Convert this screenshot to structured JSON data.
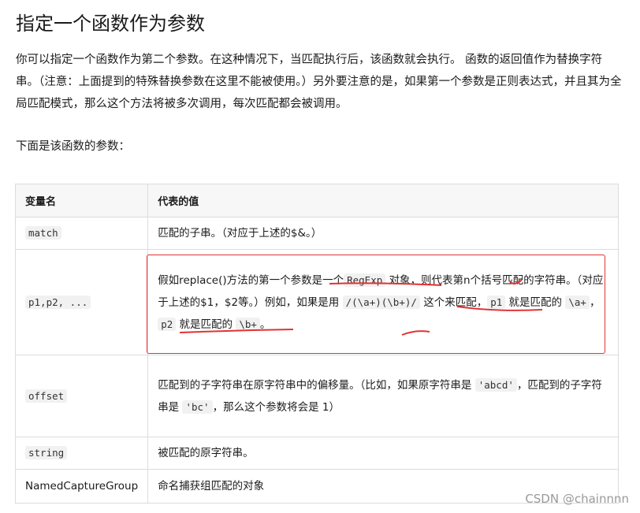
{
  "heading": "指定一个函数作为参数",
  "intro": {
    "line1": "你可以指定一个函数作为第二个参数。在这种情况下，当匹配执行后，该函数就会执行。 函数的返回值作为替换字符串。（注意：上面提到的特殊替换参数在这里不能被使用。）另外要注意的是，如果第一个参数是正则表达式，并且其为全局匹配模式，那么这个方法将被多次调用，每次匹配都会被调用。",
    "line2": "下面是该函数的参数："
  },
  "table": {
    "headers": [
      "变量名",
      "代表的值"
    ],
    "rows": [
      {
        "name": "match",
        "value": "匹配的子串。（对应于上述的$&。）"
      },
      {
        "name": "p1,p2, ...",
        "value_parts": {
          "a": "假如replace()方法的第一个参数是一个",
          "code1": "RegExp",
          "b": " 对象，则代表第n个括号匹配的字符串。（对应于上述的$1，$2等。）例如，如果是用 ",
          "code2": "/(\\a+)(\\b+)/",
          "c": " 这个来匹配，",
          "code3": "p1",
          "d": " 就是匹配的 ",
          "code4": "\\a+",
          "e": "，",
          "code5": "p2",
          "f": " 就是匹配的 ",
          "code6": "\\b+",
          "g": "。"
        }
      },
      {
        "name": "offset",
        "value_parts": {
          "a": "匹配到的子字符串在原字符串中的偏移量。（比如，如果原字符串是 ",
          "code1": "'abcd'",
          "b": "，匹配到的子字符串是 ",
          "code2": "'bc'",
          "c": "，那么这个参数将会是 1）"
        }
      },
      {
        "name": "string",
        "value": "被匹配的原字符串。"
      },
      {
        "name": "NamedCaptureGroup",
        "value": "命名捕获组匹配的对象"
      }
    ]
  },
  "watermark": "CSDN @chainnnn",
  "annotation_color": "#e23333"
}
